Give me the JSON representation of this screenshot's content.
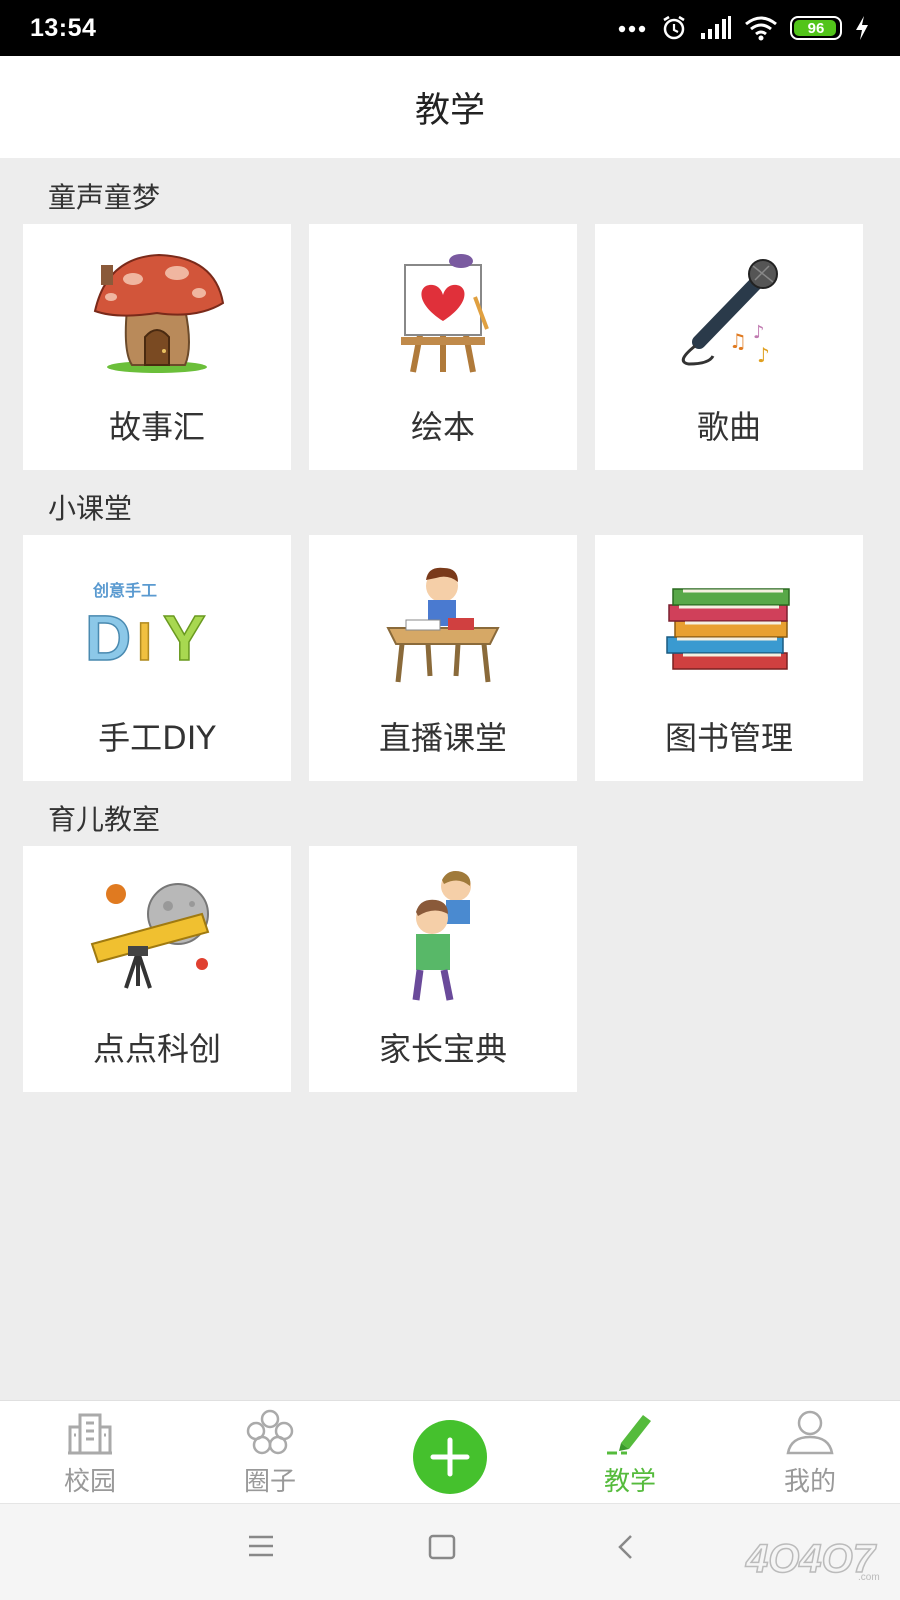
{
  "status": {
    "time": "13:54",
    "battery": "96",
    "battery_level": 0.96
  },
  "header": {
    "title": "教学"
  },
  "sections": [
    {
      "title": "童声童梦",
      "cards": [
        {
          "label": "故事汇",
          "icon": "mushroom-house-icon"
        },
        {
          "label": "绘本",
          "icon": "easel-heart-icon"
        },
        {
          "label": "歌曲",
          "icon": "microphone-icon"
        }
      ]
    },
    {
      "title": "小课堂",
      "cards": [
        {
          "label": "手工DIY",
          "icon": "diy-letters-icon"
        },
        {
          "label": "直播课堂",
          "icon": "student-desk-icon"
        },
        {
          "label": "图书管理",
          "icon": "book-stack-icon"
        }
      ]
    },
    {
      "title": "育儿教室",
      "cards": [
        {
          "label": "点点科创",
          "icon": "telescope-icon"
        },
        {
          "label": "家长宝典",
          "icon": "parent-child-icon"
        }
      ]
    }
  ],
  "bottom_nav": [
    {
      "label": "校园",
      "icon": "building-icon",
      "active": false
    },
    {
      "label": "圈子",
      "icon": "flower-icon",
      "active": false
    },
    {
      "label": "",
      "icon": "plus-icon",
      "active": false
    },
    {
      "label": "教学",
      "icon": "pen-icon",
      "active": true
    },
    {
      "label": "我的",
      "icon": "user-icon",
      "active": false
    }
  ],
  "colors": {
    "accent": "#45c12d",
    "active_text": "#55bb3c",
    "background": "#ededed"
  }
}
